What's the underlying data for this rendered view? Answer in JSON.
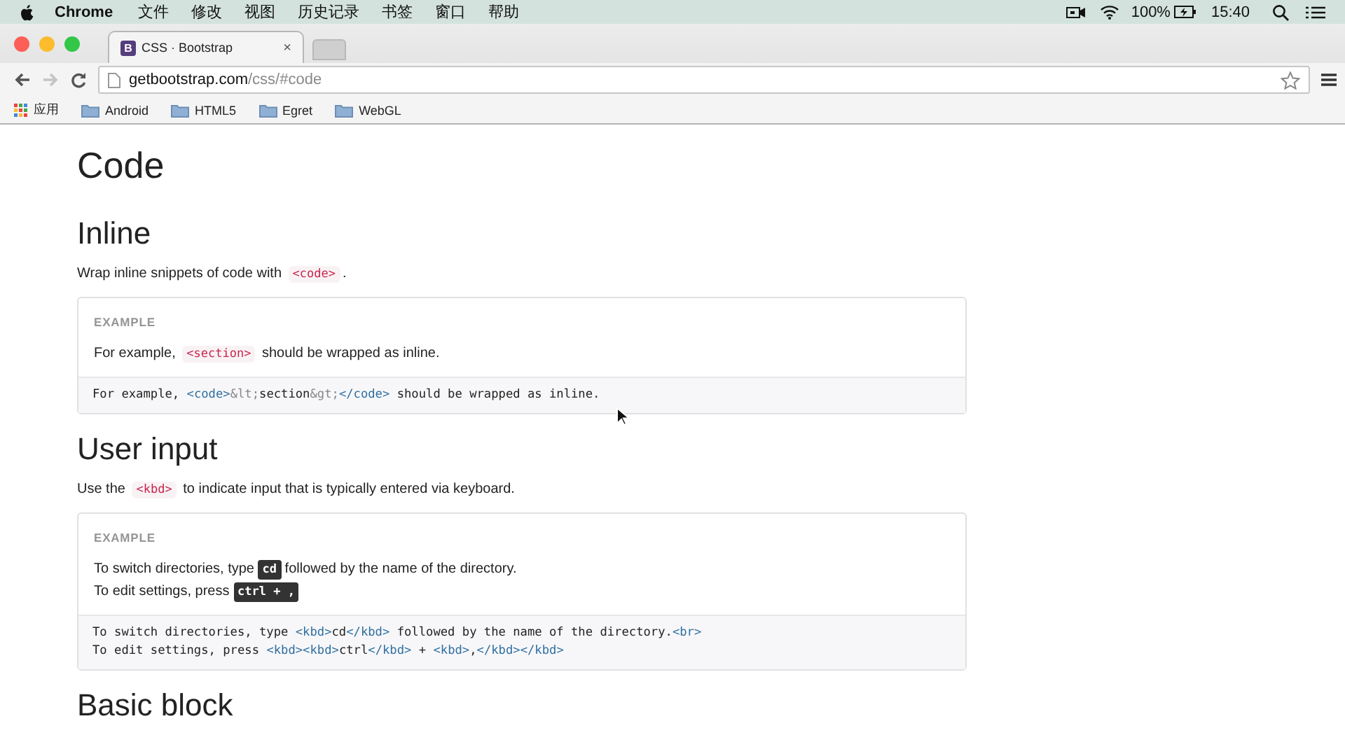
{
  "menubar": {
    "app": "Chrome",
    "menus": [
      "文件",
      "修改",
      "视图",
      "历史记录",
      "书签",
      "窗口",
      "帮助"
    ],
    "battery": "100%",
    "time": "15:40"
  },
  "browser": {
    "tabs": [
      {
        "favicon": "B",
        "title": "CSS · Bootstrap",
        "close": "×",
        "selected": true
      }
    ],
    "forward_disabled": true,
    "url": {
      "host": "getbootstrap.com",
      "path": "/css/#code"
    },
    "bookmarks": [
      {
        "kind": "apps",
        "label": "应用"
      },
      {
        "kind": "folder",
        "label": "Android"
      },
      {
        "kind": "folder",
        "label": "HTML5"
      },
      {
        "kind": "folder",
        "label": "Egret"
      },
      {
        "kind": "folder",
        "label": "WebGL"
      }
    ]
  },
  "page": {
    "title": "Code",
    "sections": [
      {
        "heading": "Inline",
        "intro": [
          {
            "kind": "text",
            "text": "Wrap inline snippets of code with "
          },
          {
            "kind": "code",
            "text": "<code>"
          },
          {
            "kind": "text",
            "text": "."
          }
        ],
        "example_label": "EXAMPLE",
        "example_lines": [
          [
            {
              "kind": "text",
              "text": "For example, "
            },
            {
              "kind": "code",
              "text": "<section>"
            },
            {
              "kind": "text",
              "text": " should be wrapped as inline."
            }
          ]
        ],
        "code_lines": [
          [
            {
              "kind": "plain",
              "text": "For example, "
            },
            {
              "kind": "tag",
              "text": "<code>"
            },
            {
              "kind": "entity",
              "text": "&lt;"
            },
            {
              "kind": "plain",
              "text": "section"
            },
            {
              "kind": "entity",
              "text": "&gt;"
            },
            {
              "kind": "tag",
              "text": "</code>"
            },
            {
              "kind": "plain",
              "text": " should be wrapped as inline."
            }
          ]
        ]
      },
      {
        "heading": "User input",
        "intro": [
          {
            "kind": "text",
            "text": "Use the "
          },
          {
            "kind": "code",
            "text": "<kbd>"
          },
          {
            "kind": "text",
            "text": " to indicate input that is typically entered via keyboard."
          }
        ],
        "example_label": "EXAMPLE",
        "example_lines": [
          [
            {
              "kind": "text",
              "text": "To switch directories, type "
            },
            {
              "kind": "kbd",
              "text": "cd"
            },
            {
              "kind": "text",
              "text": " followed by the name of the directory."
            }
          ],
          [
            {
              "kind": "text",
              "text": "To edit settings, press "
            },
            {
              "kind": "kbd",
              "text": "ctrl + ,"
            }
          ]
        ],
        "code_lines": [
          [
            {
              "kind": "plain",
              "text": "To switch directories, type "
            },
            {
              "kind": "tag",
              "text": "<kbd>"
            },
            {
              "kind": "plain",
              "text": "cd"
            },
            {
              "kind": "tag",
              "text": "</kbd>"
            },
            {
              "kind": "plain",
              "text": " followed by the name of the directory."
            },
            {
              "kind": "tag",
              "text": "<br>"
            }
          ],
          [
            {
              "kind": "plain",
              "text": "To edit settings, press "
            },
            {
              "kind": "tag",
              "text": "<kbd><kbd>"
            },
            {
              "kind": "plain",
              "text": "ctrl"
            },
            {
              "kind": "tag",
              "text": "</kbd>"
            },
            {
              "kind": "plain",
              "text": " + "
            },
            {
              "kind": "tag",
              "text": "<kbd>"
            },
            {
              "kind": "plain",
              "text": ","
            },
            {
              "kind": "tag",
              "text": "</kbd></kbd>"
            }
          ]
        ]
      },
      {
        "heading": "Basic block"
      }
    ]
  }
}
